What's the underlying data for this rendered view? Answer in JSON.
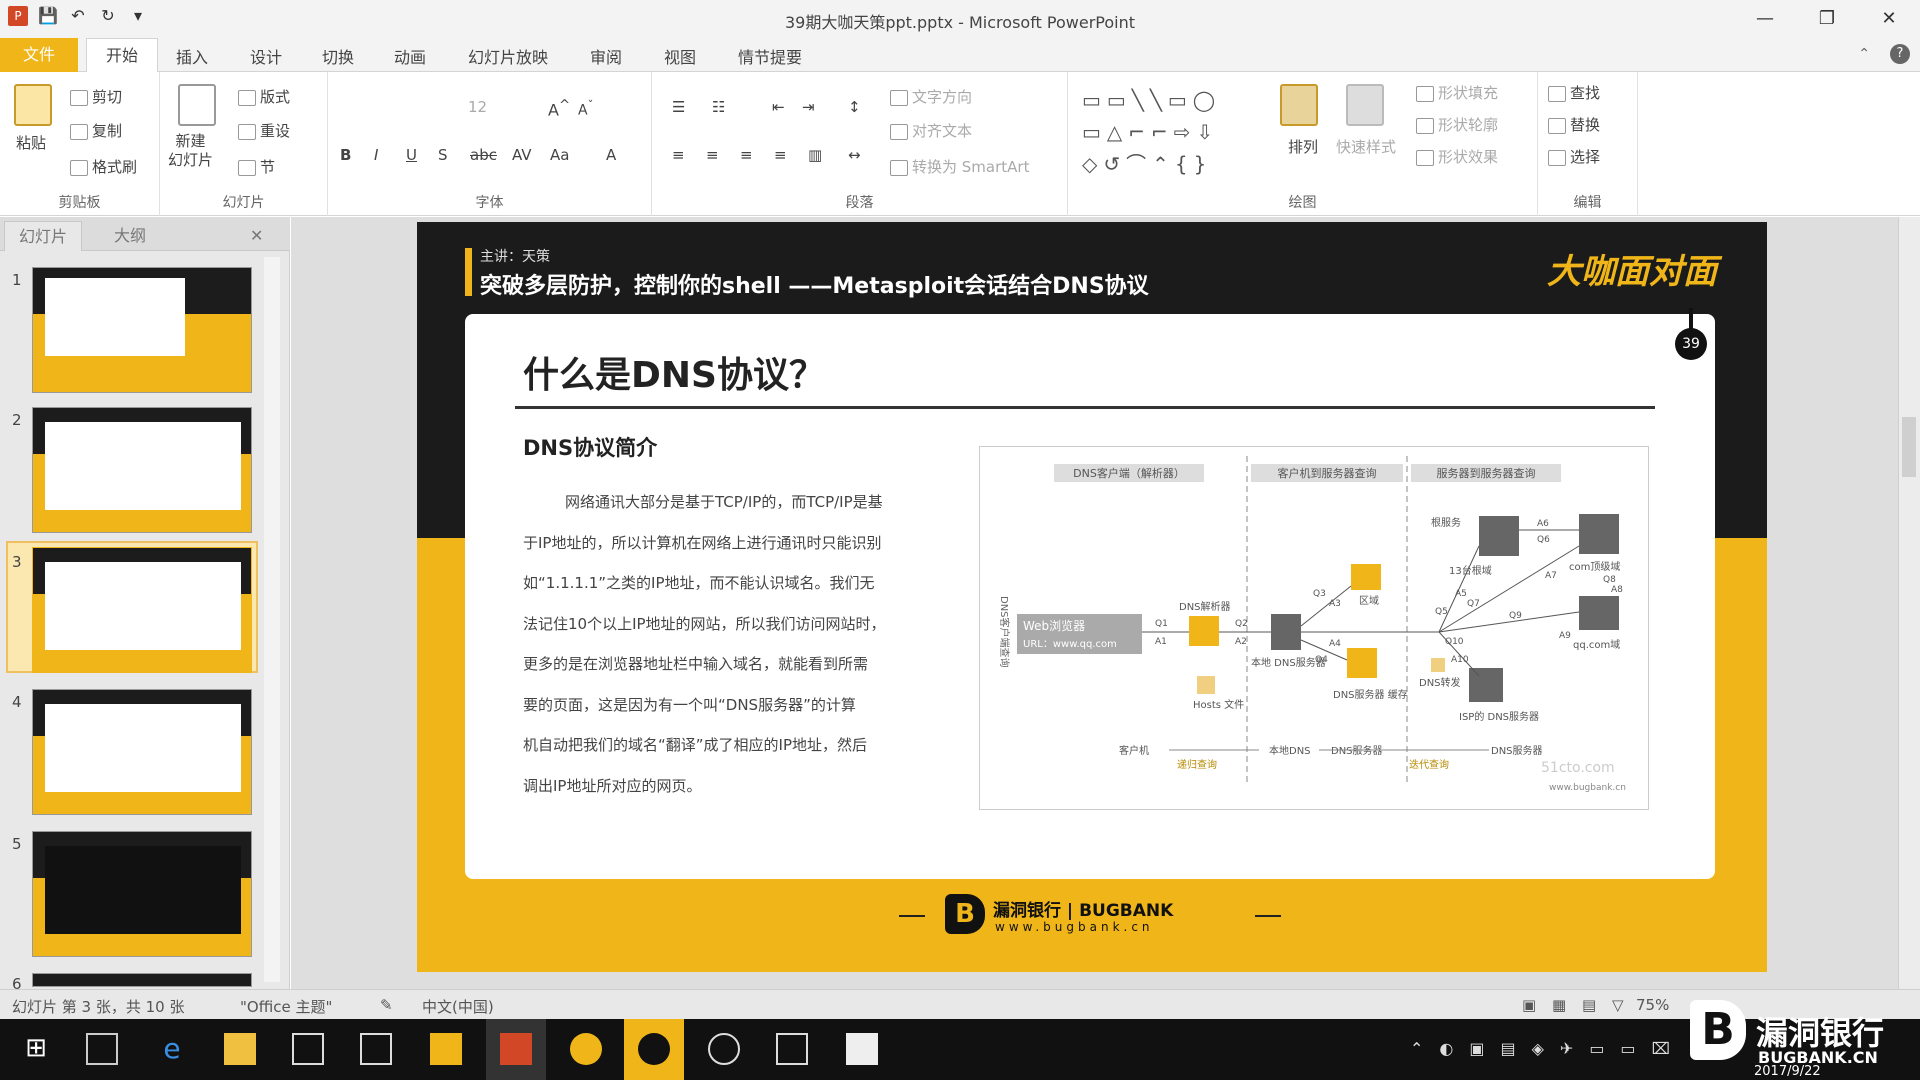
{
  "window": {
    "title": "39期大咖天策ppt.pptx - Microsoft PowerPoint",
    "min": "—",
    "restore": "❐",
    "close": "✕"
  },
  "tabs": [
    "文件",
    "开始",
    "插入",
    "设计",
    "切换",
    "动画",
    "幻灯片放映",
    "审阅",
    "视图",
    "情节提要"
  ],
  "ribbon": {
    "clipboard": {
      "paste": "粘贴",
      "cut": "剪切",
      "copy": "复制",
      "format_painter": "格式刷",
      "label": "剪贴板"
    },
    "slides": {
      "new_slide": "新建\n幻灯片",
      "layout": "版式",
      "reset": "重设",
      "section": "节",
      "label": "幻灯片"
    },
    "font": {
      "size": "12",
      "label": "字体"
    },
    "paragraph": {
      "text_direction": "文字方向",
      "align_text": "对齐文本",
      "smartart": "转换为 SmartArt",
      "label": "段落"
    },
    "drawing": {
      "arrange": "排列",
      "quick_styles": "快速样式",
      "fill": "形状填充",
      "outline": "形状轮廓",
      "effects": "形状效果",
      "label": "绘图"
    },
    "editing": {
      "find": "查找",
      "replace": "替换",
      "select": "选择",
      "label": "编辑"
    }
  },
  "pane": {
    "tab_slides": "幻灯片",
    "tab_outline": "大纲",
    "close": "✕",
    "slide_numbers": [
      "1",
      "2",
      "3",
      "4",
      "5",
      "6"
    ]
  },
  "slide": {
    "speaker": "主讲：天策",
    "banner": "突破多层防护，控制你的shell ——Metasploit会话结合DNS协议",
    "brand": "大咖面对面",
    "badge": "39",
    "heading": "什么是DNS协议？",
    "subheading": "DNS协议简介",
    "body": [
      "网络通讯大部分是基于TCP/IP的，而TCP/IP是基",
      "于IP地址的，所以计算机在网络上进行通讯时只能识别",
      "如“1.1.1.1”之类的IP地址，而不能认识域名。我们无",
      "法记住10个以上IP地址的网站，所以我们访问网站时，",
      "更多的是在浏览器地址栏中输入域名，就能看到所需",
      "要的页面，这是因为有一个叫“DNS服务器”的计算",
      "机自动把我们的域名“翻译”成了相应的IP地址，然后",
      "调出IP地址所对应的网页。"
    ],
    "diagram": {
      "col1": "DNS客户端（解析器）",
      "col2": "客户机到服务器查询",
      "col3": "服务器到服务器查询",
      "side": "DNS客户端查询",
      "browser": "Web浏览器",
      "url": "URL：www.qq.com",
      "resolver": "DNS解析器",
      "hosts": "Hosts\n文件",
      "local_dns": "本地\nDNS服务器",
      "zone": "区域",
      "cache": "DNS服务器\n缓存",
      "root": "根服务",
      "tld": "13台根域",
      "com": "com顶级域",
      "qq": "qq.com域",
      "forwarder": "DNS转发",
      "isp": "ISP的\nDNS服务器",
      "client": "客户机",
      "recursive": "递归查询",
      "local": "本地DNS",
      "server1": "DNS服务器",
      "iterative": "迭代查询",
      "server2": "DNS服务器",
      "wm1": "51cto.com",
      "wm2": "www.bugbank.cn",
      "labels": [
        "Q1",
        "A1",
        "Q2",
        "A2",
        "Q3",
        "A3",
        "Q4",
        "A4",
        "Q5",
        "A5",
        "Q6",
        "A6",
        "Q7",
        "A7",
        "Q8",
        "A8",
        "Q9",
        "A9",
        "Q10",
        "A10"
      ]
    },
    "footer_cn": "漏洞银行",
    "footer_sep": "|",
    "footer_en": "BUGBANK",
    "footer_url": "www.bugbank.cn"
  },
  "status": {
    "slide_info": "幻灯片 第 3 张，共 10 张",
    "theme": "\"Office 主题\"",
    "lang": "中文(中国)",
    "zoom": "75%"
  },
  "watermark": {
    "cn": "漏洞银行",
    "en": "BUGBANK.CN",
    "date": "2017/9/22"
  },
  "colors": {
    "accent": "#f0b619",
    "dark": "#1b1b1b"
  }
}
